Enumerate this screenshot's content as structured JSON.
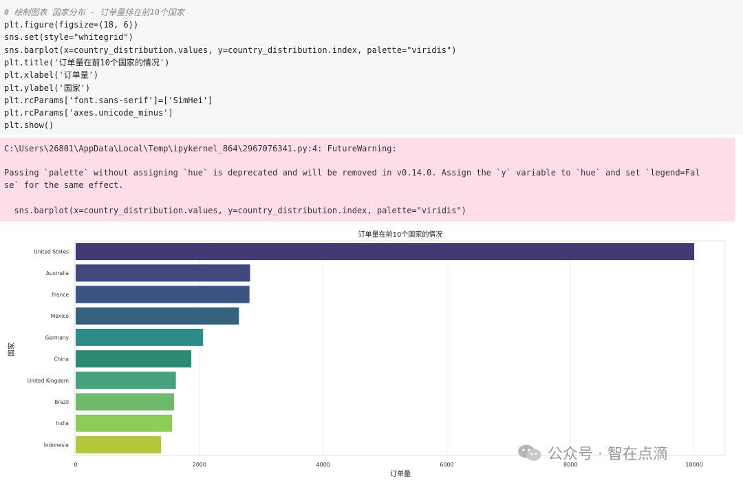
{
  "code_cell": {
    "lines": [
      "# 绘制图表 国家分布 - 订单量排在前10个国家",
      "plt.figure(figsize=(18, 6))",
      "sns.set(style=\"whitegrid\")",
      "sns.barplot(x=country_distribution.values, y=country_distribution.index, palette=\"viridis\")",
      "plt.title('订单量在前10个国家的情况')",
      "plt.xlabel('订单量')",
      "plt.ylabel('国家')",
      "plt.rcParams['font.sans-serif']=['SimHei']",
      "plt.rcParams['axes.unicode_minus']",
      "plt.show()"
    ]
  },
  "stderr": {
    "path_line": "C:\\Users\\26801\\AppData\\Local\\Temp\\ipykernel_864\\2967076341.py:4: FutureWarning:",
    "message_line1": "Passing `palette` without assigning `hue` is deprecated and will be removed in v0.14.0. Assign the `y` variable to `hue` and set `legend=Fal",
    "message_line2": "se` for the same effect.",
    "code_line": "  sns.barplot(x=country_distribution.values, y=country_distribution.index, palette=\"viridis\")"
  },
  "watermark": {
    "text": "公众号 · 智在点滴"
  },
  "chart_data": {
    "type": "bar",
    "orientation": "horizontal",
    "title": "订单量在前10个国家的情况",
    "xlabel": "订单量",
    "ylabel": "国家",
    "xlim": [
      0,
      10500
    ],
    "xticks": [
      0,
      2000,
      4000,
      6000,
      8000,
      10000
    ],
    "grid": true,
    "categories": [
      "United States",
      "Australia",
      "France",
      "Mexico",
      "Germany",
      "China",
      "United Kingdom",
      "Brazil",
      "India",
      "Indonesia"
    ],
    "values": [
      10000,
      2820,
      2810,
      2640,
      2060,
      1870,
      1620,
      1590,
      1560,
      1380
    ],
    "colors": [
      "#423a73",
      "#41487d",
      "#3d5384",
      "#35627f",
      "#2c8a87",
      "#2a8a73",
      "#44a27c",
      "#6cba6a",
      "#8ecc58",
      "#b4c738"
    ]
  }
}
